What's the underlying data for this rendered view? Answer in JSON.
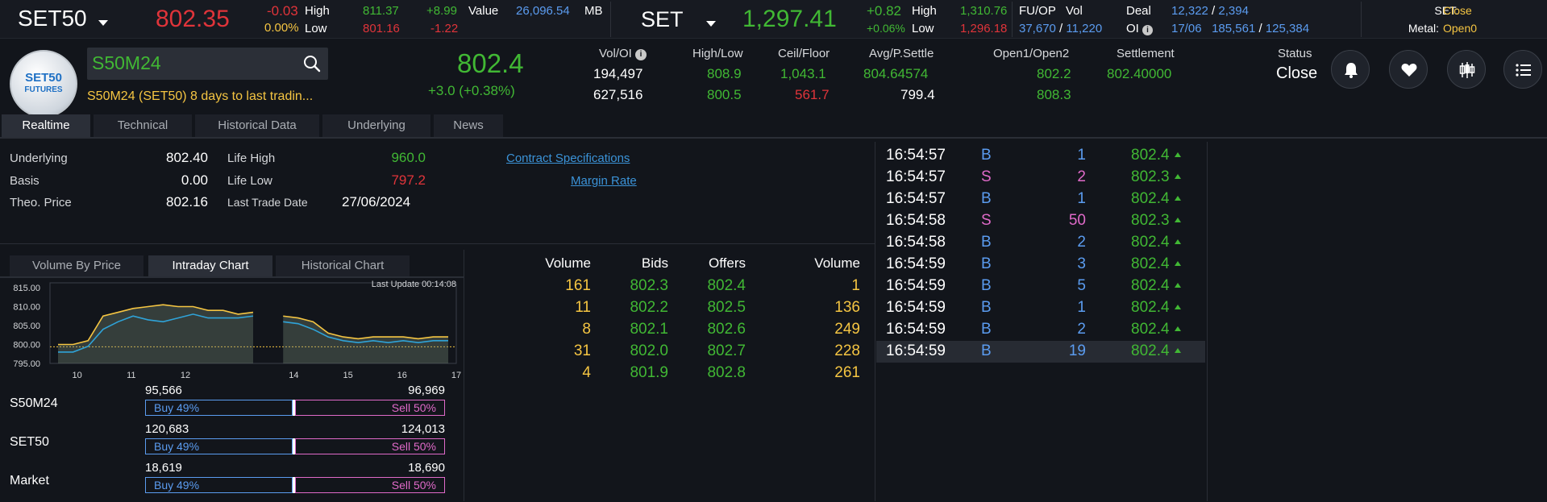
{
  "top": {
    "set50": {
      "name": "SET50",
      "price": "802.35",
      "change": "-0.03",
      "pct": "0.00%",
      "high_label": "High",
      "low_label": "Low",
      "high": "811.37",
      "low": "801.16",
      "high_chg": "+8.99",
      "low_chg": "-1.22",
      "value_label": "Value",
      "value": "26,096.54",
      "value_unit": "MB"
    },
    "set": {
      "name": "SET",
      "price": "1,297.41",
      "change": "+0.82",
      "pct": "+0.06%",
      "high_label": "High",
      "low_label": "Low",
      "high": "1,310.76",
      "low": "1,296.18"
    },
    "fuop": {
      "label": "FU/OP",
      "vol_label": "Vol",
      "vol_a": "37,670",
      "vol_b": "11,220",
      "deal_label": "Deal",
      "oi_label": "OI",
      "deal_a": "12,322",
      "deal_b": "2,394",
      "oi_date": "17/06",
      "oi_a": "185,561",
      "oi_b": "125,384"
    },
    "status": {
      "set_label": "SET:",
      "set_value": "Close",
      "metal_label": "Metal:",
      "metal_value": "Open0"
    }
  },
  "header": {
    "logo_line1": "SET50",
    "logo_line2": "FUTURES",
    "symbol": "S50M24",
    "note": "S50M24 (SET50) 8 days to last tradin...",
    "last": "802.4",
    "change": "+3.0 (+0.38%)",
    "cols": {
      "voloi_label": "Vol/OI",
      "vol": "194,497",
      "oi": "627,516",
      "highlow_label": "High/Low",
      "high": "808.9",
      "low": "800.5",
      "ceilfloor_label": "Ceil/Floor",
      "ceil": "1,043.1",
      "floor": "561.7",
      "avg_label": "Avg/P.Settle",
      "avg": "804.64574",
      "psettle": "799.4",
      "open_label": "Open1/Open2",
      "open1": "802.2",
      "open2": "808.3",
      "settle_label": "Settlement",
      "settle": "802.40000",
      "status_label": "Status",
      "status": "Close"
    }
  },
  "tabs": [
    "Realtime",
    "Technical",
    "Historical Data",
    "Underlying",
    "News"
  ],
  "info": {
    "underlying_label": "Underlying",
    "underlying": "802.40",
    "basis_label": "Basis",
    "basis": "0.00",
    "theo_label": "Theo. Price",
    "theo": "802.16",
    "lifehigh_label": "Life High",
    "lifehigh": "960.0",
    "lifelow_label": "Life Low",
    "lifelow": "797.2",
    "ltd_label": "Last Trade Date",
    "ltd": "27/06/2024",
    "link1": "Contract Specifications",
    "link2": "Margin Rate"
  },
  "chart_tabs": [
    "Volume By Price",
    "Intraday Chart",
    "Historical Chart"
  ],
  "chart_data": {
    "type": "line",
    "title": "Last Update 00:14:08",
    "x_ticks": [
      "10",
      "11",
      "12",
      "14",
      "15",
      "16",
      "17"
    ],
    "y_ticks": [
      "815.00",
      "810.00",
      "805.00",
      "800.00",
      "795.00"
    ],
    "ylim": [
      795,
      815
    ],
    "series": [
      {
        "values": [
          800.0,
          800.0,
          801.0,
          807.5,
          808.5,
          809.5,
          810.0,
          810.5,
          810.0,
          810.0,
          809.0,
          809.0,
          808.0,
          808.5,
          null,
          807.5,
          807.0,
          806.0,
          803.0,
          802.0,
          801.5,
          802.0,
          802.0,
          802.0,
          801.5,
          802.0,
          802.0
        ]
      },
      {
        "values": [
          798.0,
          798.0,
          799.5,
          804.0,
          806.0,
          807.5,
          806.5,
          806.0,
          807.0,
          808.0,
          807.0,
          807.0,
          807.0,
          807.5,
          null,
          806.0,
          805.5,
          804.0,
          802.0,
          801.0,
          800.5,
          801.0,
          800.5,
          801.0,
          800.5,
          801.0,
          801.0
        ]
      }
    ],
    "reference_line": 799.4
  },
  "bs": [
    {
      "name": "S50M24",
      "buy_vol": "95,566",
      "sell_vol": "96,969",
      "buy": "Buy 49%",
      "sell": "Sell 50%"
    },
    {
      "name": "SET50",
      "buy_vol": "120,683",
      "sell_vol": "124,013",
      "buy": "Buy 49%",
      "sell": "Sell 50%"
    },
    {
      "name": "Market",
      "buy_vol": "18,619",
      "sell_vol": "18,690",
      "buy": "Buy 49%",
      "sell": "Sell 50%"
    }
  ],
  "orderbook": {
    "headers": [
      "Volume",
      "Bids",
      "Offers",
      "Volume"
    ],
    "rows": [
      [
        "161",
        "802.3",
        "802.4",
        "1"
      ],
      [
        "11",
        "802.2",
        "802.5",
        "136"
      ],
      [
        "8",
        "802.1",
        "802.6",
        "249"
      ],
      [
        "31",
        "802.0",
        "802.7",
        "228"
      ],
      [
        "4",
        "801.9",
        "802.8",
        "261"
      ]
    ]
  },
  "ticks": [
    {
      "time": "16:54:57",
      "side": "B",
      "vol": "1",
      "price": "802.4"
    },
    {
      "time": "16:54:57",
      "side": "S",
      "vol": "2",
      "price": "802.3"
    },
    {
      "time": "16:54:57",
      "side": "B",
      "vol": "1",
      "price": "802.4"
    },
    {
      "time": "16:54:58",
      "side": "S",
      "vol": "50",
      "price": "802.3"
    },
    {
      "time": "16:54:58",
      "side": "B",
      "vol": "2",
      "price": "802.4"
    },
    {
      "time": "16:54:59",
      "side": "B",
      "vol": "3",
      "price": "802.4"
    },
    {
      "time": "16:54:59",
      "side": "B",
      "vol": "5",
      "price": "802.4"
    },
    {
      "time": "16:54:59",
      "side": "B",
      "vol": "1",
      "price": "802.4"
    },
    {
      "time": "16:54:59",
      "side": "B",
      "vol": "2",
      "price": "802.4"
    },
    {
      "time": "16:54:59",
      "side": "B",
      "vol": "19",
      "price": "802.4"
    }
  ],
  "colors": {
    "up": "#41b834",
    "down": "#e0343a",
    "yellow": "#f5c542",
    "buy": "#5b9cf0",
    "sell": "#e06ac9"
  }
}
